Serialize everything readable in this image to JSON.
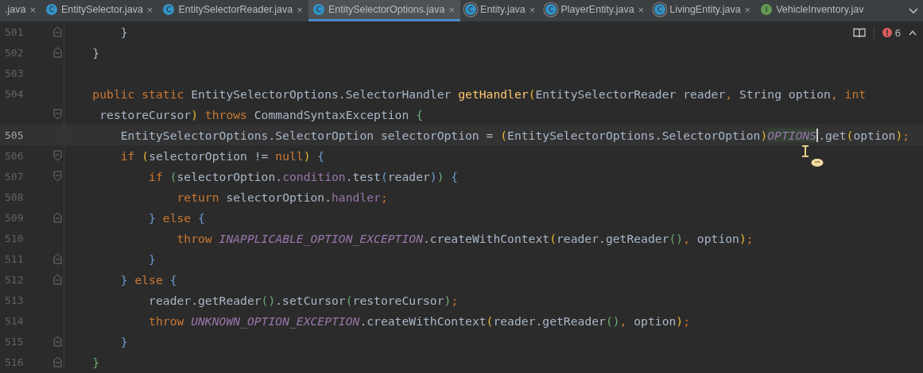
{
  "tabs": [
    {
      "label": ".java",
      "kind": "none",
      "selected": false,
      "close": "×"
    },
    {
      "label": "EntitySelector.java",
      "kind": "class",
      "icon_letter": "C",
      "selected": false,
      "close": "×"
    },
    {
      "label": "EntitySelectorReader.java",
      "kind": "class",
      "icon_letter": "C",
      "selected": false,
      "close": "×"
    },
    {
      "label": "EntitySelectorOptions.java",
      "kind": "class",
      "icon_letter": "C",
      "selected": true,
      "close": "×"
    },
    {
      "label": "Entity.java",
      "kind": "abstract",
      "icon_letter": "C",
      "selected": false,
      "close": "×"
    },
    {
      "label": "PlayerEntity.java",
      "kind": "abstract",
      "icon_letter": "C",
      "selected": false,
      "close": "×"
    },
    {
      "label": "LivingEntity.java",
      "kind": "abstract",
      "icon_letter": "C",
      "selected": false,
      "close": "×"
    },
    {
      "label": "VehicleInventory.jav",
      "kind": "interface",
      "icon_letter": "I",
      "selected": false
    }
  ],
  "inspections": {
    "error_count": "6"
  },
  "lines": [
    {
      "number": "501",
      "fold_start": false,
      "fold_end": true,
      "current": false,
      "tokens": [
        {
          "kind": "text",
          "text": "        }"
        }
      ]
    },
    {
      "number": "502",
      "fold_start": false,
      "fold_end": true,
      "current": false,
      "tokens": [
        {
          "kind": "text",
          "text": "    }"
        }
      ]
    },
    {
      "number": "503",
      "fold_start": false,
      "fold_end": false,
      "current": false
    },
    {
      "number": "504",
      "fold_start": false,
      "fold_end": false,
      "current": false,
      "tokens": [
        {
          "kind": "kw",
          "text": "    public static "
        },
        {
          "kind": "text",
          "text": "EntitySelectorOptions.SelectorHandler "
        },
        {
          "kind": "method",
          "text": "getHandler"
        },
        {
          "kind": "b1",
          "text": "("
        },
        {
          "kind": "text",
          "text": "EntitySelectorReader reader"
        },
        {
          "kind": "kw",
          "text": ", "
        },
        {
          "kind": "text",
          "text": "String option"
        },
        {
          "kind": "kw",
          "text": ", int"
        }
      ]
    },
    {
      "fold_start": true,
      "fold_end": false,
      "current": false,
      "tokens": [
        {
          "kind": "text",
          "text": "     restoreCursor"
        },
        {
          "kind": "b1",
          "text": ")"
        },
        {
          "kind": "kw",
          "text": " throws "
        },
        {
          "kind": "text",
          "text": "CommandSyntaxException "
        },
        {
          "kind": "b2",
          "text": "{"
        }
      ]
    },
    {
      "number": "505",
      "fold_start": false,
      "fold_end": false,
      "current": true,
      "tokens": [
        {
          "kind": "text",
          "text": "        EntitySelectorOptions.SelectorOption selectorOption = "
        },
        {
          "kind": "b1",
          "text": "("
        },
        {
          "kind": "text",
          "text": "EntitySelectorOptions.SelectorOption"
        },
        {
          "kind": "b1",
          "text": ")"
        },
        {
          "kind": "marked_constant",
          "text": "OPTIONS"
        },
        {
          "kind": "text",
          "text": ".get"
        },
        {
          "kind": "b1",
          "text": "("
        },
        {
          "kind": "text",
          "text": "option"
        },
        {
          "kind": "b1",
          "text": ")"
        },
        {
          "kind": "kw",
          "text": ";"
        }
      ]
    },
    {
      "number": "506",
      "fold_start": true,
      "fold_end": false,
      "current": false,
      "tokens": [
        {
          "kind": "kw",
          "text": "        if "
        },
        {
          "kind": "b1",
          "text": "("
        },
        {
          "kind": "text",
          "text": "selectorOption != "
        },
        {
          "kind": "kw",
          "text": "null"
        },
        {
          "kind": "b1",
          "text": ")"
        },
        {
          "kind": "b3",
          "text": " {"
        }
      ]
    },
    {
      "number": "507",
      "fold_start": true,
      "fold_end": false,
      "current": false,
      "tokens": [
        {
          "kind": "kw",
          "text": "            if "
        },
        {
          "kind": "b2",
          "text": "("
        },
        {
          "kind": "text",
          "text": "selectorOption."
        },
        {
          "kind": "field",
          "text": "condition"
        },
        {
          "kind": "text",
          "text": ".test"
        },
        {
          "kind": "b3",
          "text": "("
        },
        {
          "kind": "text",
          "text": "reader"
        },
        {
          "kind": "b3",
          "text": ")"
        },
        {
          "kind": "b2",
          "text": ")"
        },
        {
          "kind": "b3",
          "text": " {"
        }
      ]
    },
    {
      "number": "508",
      "fold_start": false,
      "fold_end": false,
      "current": false,
      "tokens": [
        {
          "kind": "kw",
          "text": "                return "
        },
        {
          "kind": "text",
          "text": "selectorOption."
        },
        {
          "kind": "field",
          "text": "handler"
        },
        {
          "kind": "kw",
          "text": ";"
        }
      ]
    },
    {
      "number": "509",
      "fold_start": false,
      "fold_end": true,
      "current": false,
      "tokens": [
        {
          "kind": "b3",
          "text": "            }"
        },
        {
          "kind": "kw",
          "text": " else "
        },
        {
          "kind": "b3",
          "text": "{"
        }
      ]
    },
    {
      "number": "510",
      "fold_start": false,
      "fold_end": false,
      "current": false,
      "tokens": [
        {
          "kind": "kw",
          "text": "                throw "
        },
        {
          "kind": "constant",
          "text": "INAPPLICABLE_OPTION_EXCEPTION"
        },
        {
          "kind": "text",
          "text": ".createWithContext"
        },
        {
          "kind": "b1",
          "text": "("
        },
        {
          "kind": "text",
          "text": "reader.getReader"
        },
        {
          "kind": "b2",
          "text": "()"
        },
        {
          "kind": "kw",
          "text": ", "
        },
        {
          "kind": "text",
          "text": "option"
        },
        {
          "kind": "b1",
          "text": ")"
        },
        {
          "kind": "kw",
          "text": ";"
        }
      ]
    },
    {
      "number": "511",
      "fold_start": false,
      "fold_end": true,
      "current": false,
      "tokens": [
        {
          "kind": "b3",
          "text": "            }"
        }
      ]
    },
    {
      "number": "512",
      "fold_start": false,
      "fold_end": true,
      "current": false,
      "tokens": [
        {
          "kind": "b3",
          "text": "        }"
        },
        {
          "kind": "kw",
          "text": " else "
        },
        {
          "kind": "b3",
          "text": "{"
        }
      ]
    },
    {
      "number": "513",
      "fold_start": false,
      "fold_end": false,
      "current": false,
      "tokens": [
        {
          "kind": "text",
          "text": "            reader.getReader"
        },
        {
          "kind": "b2",
          "text": "()"
        },
        {
          "kind": "text",
          "text": ".setCursor"
        },
        {
          "kind": "b2",
          "text": "("
        },
        {
          "kind": "text",
          "text": "restoreCursor"
        },
        {
          "kind": "b2",
          "text": ")"
        },
        {
          "kind": "kw",
          "text": ";"
        }
      ]
    },
    {
      "number": "514",
      "fold_start": false,
      "fold_end": false,
      "current": false,
      "tokens": [
        {
          "kind": "kw",
          "text": "            throw "
        },
        {
          "kind": "constant",
          "text": "UNKNOWN_OPTION_EXCEPTION"
        },
        {
          "kind": "text",
          "text": ".createWithContext"
        },
        {
          "kind": "b1",
          "text": "("
        },
        {
          "kind": "text",
          "text": "reader.getReader"
        },
        {
          "kind": "b2",
          "text": "()"
        },
        {
          "kind": "kw",
          "text": ", "
        },
        {
          "kind": "text",
          "text": "option"
        },
        {
          "kind": "b1",
          "text": ")"
        },
        {
          "kind": "kw",
          "text": ";"
        }
      ]
    },
    {
      "number": "515",
      "fold_start": false,
      "fold_end": true,
      "current": false,
      "tokens": [
        {
          "kind": "b3",
          "text": "        }"
        }
      ]
    },
    {
      "number": "516",
      "fold_start": false,
      "fold_end": true,
      "current": false,
      "tokens": [
        {
          "kind": "b2",
          "text": "    }"
        }
      ]
    }
  ]
}
